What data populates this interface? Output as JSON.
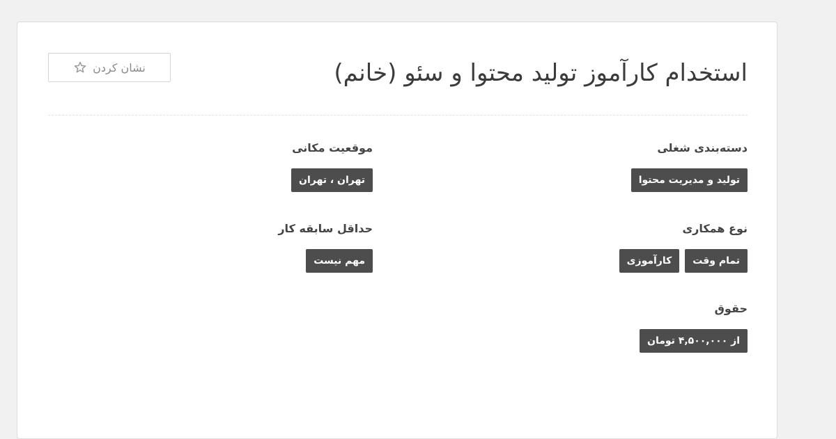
{
  "job": {
    "title": "استخدام کارآموز تولید محتوا و سئو (خانم)",
    "bookmark_label": "نشان کردن",
    "bookmark_icon": "star-icon"
  },
  "fields": {
    "category": {
      "label": "دسته‌بندی شغلی",
      "tags": [
        "تولید و مدیریت محتوا"
      ]
    },
    "location": {
      "label": "موقعیت مکانی",
      "tags": [
        "تهران ، تهران"
      ]
    },
    "cooperation_type": {
      "label": "نوع همکاری",
      "tags": [
        "تمام وقت",
        "کارآموزی"
      ]
    },
    "min_experience": {
      "label": "حداقل سابقه کار",
      "tags": [
        "مهم نیست"
      ]
    },
    "salary": {
      "label": "حقوق",
      "tags": [
        "از ۴,۵۰۰,۰۰۰ تومان"
      ]
    }
  },
  "colors": {
    "tag_background": "#4d4d4d",
    "page_background": "#f1f1f1",
    "card_background": "#ffffff",
    "title_text": "#3b3b3b"
  }
}
